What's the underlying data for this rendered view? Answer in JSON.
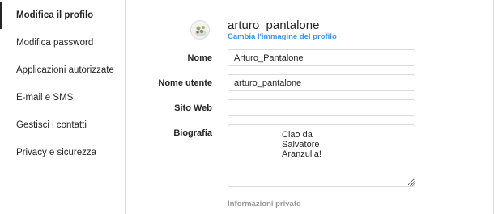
{
  "sidebar": {
    "items": [
      {
        "label": "Modifica il profilo",
        "active": true
      },
      {
        "label": "Modifica password",
        "active": false
      },
      {
        "label": "Applicazioni autorizzate",
        "active": false
      },
      {
        "label": "E-mail e SMS",
        "active": false
      },
      {
        "label": "Gestisci i contatti",
        "active": false
      },
      {
        "label": "Privacy e sicurezza",
        "active": false
      }
    ]
  },
  "profile": {
    "username": "arturo_pantalone",
    "change_photo_label": "Cambia l'immagine del profilo",
    "avatar_icon": "avatar-icon"
  },
  "form": {
    "name_label": "Nome",
    "name_value": "Arturo_Pantalone",
    "username_label": "Nome utente",
    "username_value": "arturo_pantalone",
    "website_label": "Sito Web",
    "website_value": "",
    "bio_label": "Biografia",
    "bio_value": "Ciao da\nSalvatore\nAranzulla!",
    "private_info_label": "Informazioni private"
  },
  "colors": {
    "link": "#3897f0",
    "border": "#dbdbdb",
    "text": "#262626",
    "muted": "#999999"
  }
}
